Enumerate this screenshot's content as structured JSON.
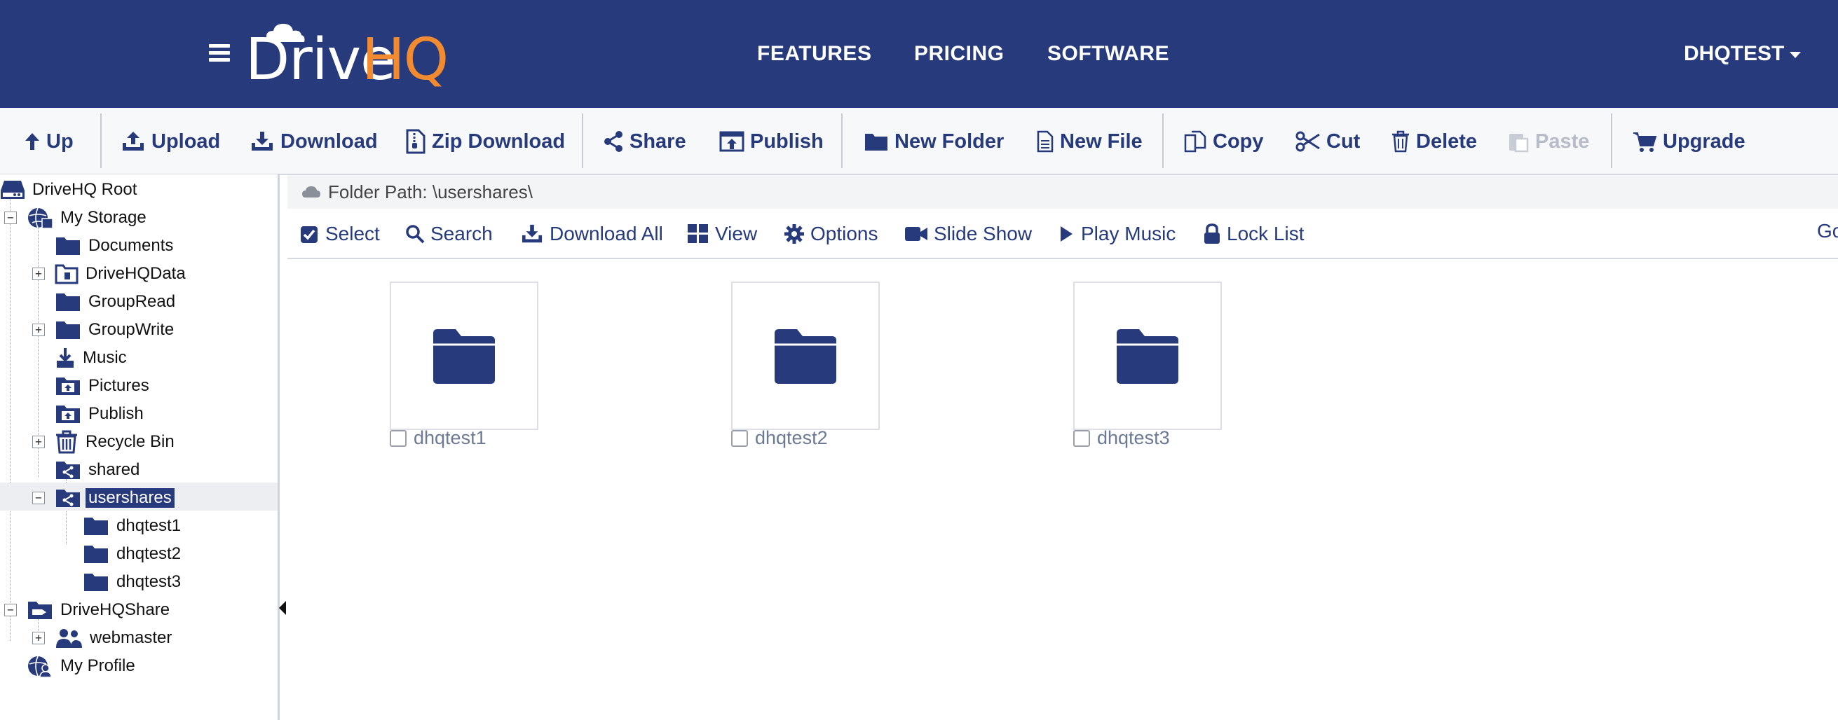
{
  "header": {
    "logo_drive": "Drive",
    "logo_hq": "HQ",
    "nav": [
      "FEATURES",
      "PRICING",
      "SOFTWARE"
    ],
    "user": "DHQTEST",
    "brand_color": "#273a7b",
    "accent_color": "#f28b30"
  },
  "toolbar": {
    "up": "Up",
    "upload": "Upload",
    "download": "Download",
    "zip_download": "Zip Download",
    "share": "Share",
    "publish": "Publish",
    "new_folder": "New Folder",
    "new_file": "New File",
    "copy": "Copy",
    "cut": "Cut",
    "delete": "Delete",
    "paste": "Paste",
    "upgrade": "Upgrade"
  },
  "tree": {
    "root": "DriveHQ Root",
    "my_storage": "My Storage",
    "documents": "Documents",
    "drivehqdata": "DriveHQData",
    "groupread": "GroupRead",
    "groupwrite": "GroupWrite",
    "music": "Music",
    "pictures": "Pictures",
    "publish": "Publish",
    "recycle_bin": "Recycle Bin",
    "shared": "shared",
    "usershares": "usershares",
    "sub1": "dhqtest1",
    "sub2": "dhqtest2",
    "sub3": "dhqtest3",
    "drivehqshare": "DriveHQShare",
    "webmaster": "webmaster",
    "my_profile": "My Profile"
  },
  "main": {
    "folder_path": "Folder Path: \\usershares\\",
    "actions": {
      "select": "Select",
      "search": "Search",
      "download_all": "Download All",
      "view": "View",
      "options": "Options",
      "slide_show": "Slide Show",
      "play_music": "Play Music",
      "lock_list": "Lock List"
    },
    "go_fragment": "Go",
    "folders": [
      "dhqtest1",
      "dhqtest2",
      "dhqtest3"
    ]
  }
}
